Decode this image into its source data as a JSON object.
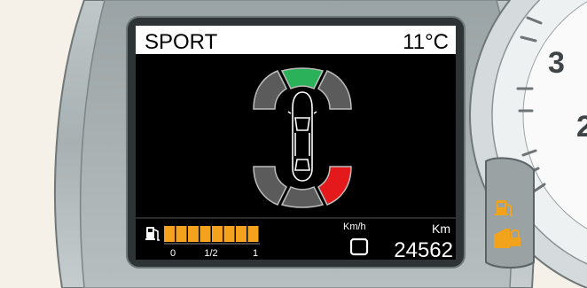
{
  "display": {
    "mode": "SPORT",
    "temperature": "11°C",
    "speed_unit": "Km/h",
    "odometer_unit": "Km",
    "odometer": "24562",
    "speed_value": "",
    "fuel": {
      "scale_labels": [
        "0",
        "1/2",
        "1"
      ],
      "level_fraction": 1.0,
      "segments": 8
    }
  },
  "parking_sensors": {
    "front": [
      {
        "id": "front-left",
        "status": "clear"
      },
      {
        "id": "front-center",
        "status": "active"
      },
      {
        "id": "front-right",
        "status": "clear"
      }
    ],
    "rear": [
      {
        "id": "rear-left",
        "status": "clear"
      },
      {
        "id": "rear-center",
        "status": "clear"
      },
      {
        "id": "rear-right",
        "status": "alert"
      }
    ]
  },
  "tachometer": {
    "visible_numbers": [
      "3",
      "2"
    ]
  },
  "colors": {
    "sensor_clear": "#5b5b5b",
    "sensor_active": "#2bb15a",
    "sensor_alert": "#e3191b",
    "fuel_bar": "#f4a21d",
    "lcd_bg": "#000000",
    "lcd_header": "#ffffff",
    "warning_icon": "#f2a31c"
  },
  "icons": {
    "fuel_pump": "fuel-pump-icon",
    "fuel_warning": "fuel-warning-icon",
    "door_lock": "door-lock-icon"
  }
}
